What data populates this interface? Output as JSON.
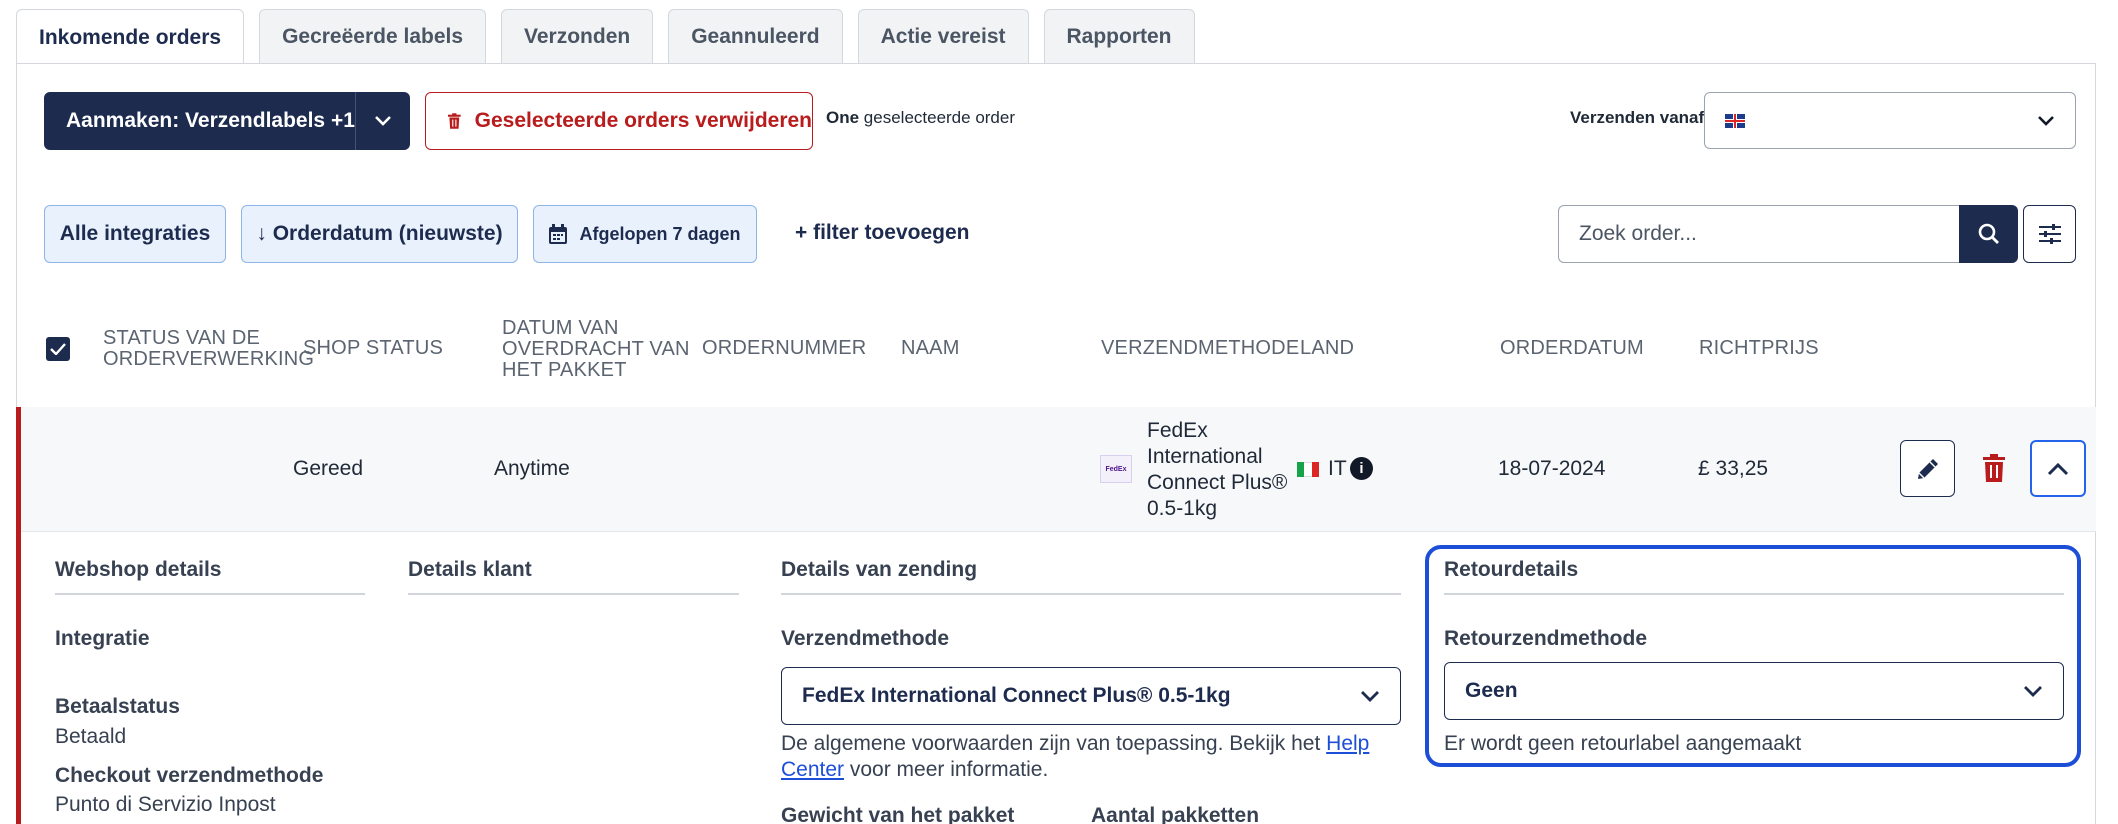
{
  "tabs": [
    {
      "label": "Inkomende orders",
      "active": true
    },
    {
      "label": "Gecreëerde labels",
      "active": false
    },
    {
      "label": "Verzonden",
      "active": false
    },
    {
      "label": "Geannuleerd",
      "active": false
    },
    {
      "label": "Actie vereist",
      "active": false
    },
    {
      "label": "Rapporten",
      "active": false
    }
  ],
  "actions": {
    "create_label": "Aanmaken: Verzendlabels +1",
    "delete_label": "Geselecteerde orders verwijderen",
    "selected_bold": "One",
    "selected_rest": "geselecteerde order",
    "ship_from_label": "Verzenden vanaf",
    "ship_from_value_icon": "uk-flag-icon"
  },
  "filters": {
    "integrations": "Alle integraties",
    "sort": "↓ Orderdatum (nieuwste)",
    "date_range": "Afgelopen 7 dagen",
    "add_filter": "+ filter toevoegen",
    "search_placeholder": "Zoek order..."
  },
  "table": {
    "headers": {
      "processing_status": "STATUS VAN DE ORDERVERWERKING",
      "shop_status": "SHOP STATUS",
      "handover_date": "DATUM VAN OVERDRACHT VAN HET PAKKET",
      "order_number": "ORDERNUMMER",
      "name": "NAAM",
      "shipping_method": "VERZENDMETHODE",
      "country": "LAND",
      "order_date": "ORDERDATUM",
      "price": "RICHTPRIJS"
    },
    "row": {
      "shop_status": "Gereed",
      "handover_date": "Anytime",
      "shipping_method_lines": [
        "FedEx",
        "International",
        "Connect Plus®",
        "0.5-1kg"
      ],
      "country": "IT",
      "order_date": "18-07-2024",
      "price": "£ 33,25"
    }
  },
  "details": {
    "webshop": {
      "title": "Webshop details",
      "integration_label": "Integratie",
      "payment_status_label": "Betaalstatus",
      "payment_status_value": "Betaald",
      "checkout_method_label": "Checkout verzendmethode",
      "checkout_method_value": "Punto di Servizio Inpost"
    },
    "customer": {
      "title": "Details klant"
    },
    "shipment": {
      "title": "Details van zending",
      "method_label": "Verzendmethode",
      "method_value": "FedEx International Connect Plus® 0.5-1kg",
      "note_prefix": "De algemene voorwaarden zijn van toepassing. Bekijk het",
      "note_link": "Help Center",
      "note_suffix": "voor meer informatie.",
      "weight_label": "Gewicht van het pakket",
      "packages_label": "Aantal pakketten"
    },
    "return": {
      "title": "Retourdetails",
      "method_label": "Retourzendmethode",
      "method_value": "Geen",
      "note": "Er wordt geen retourlabel aangemaakt"
    }
  },
  "colors": {
    "primary": "#1d2b4f",
    "danger": "#b91c1c",
    "focus": "#1d4ed8"
  }
}
